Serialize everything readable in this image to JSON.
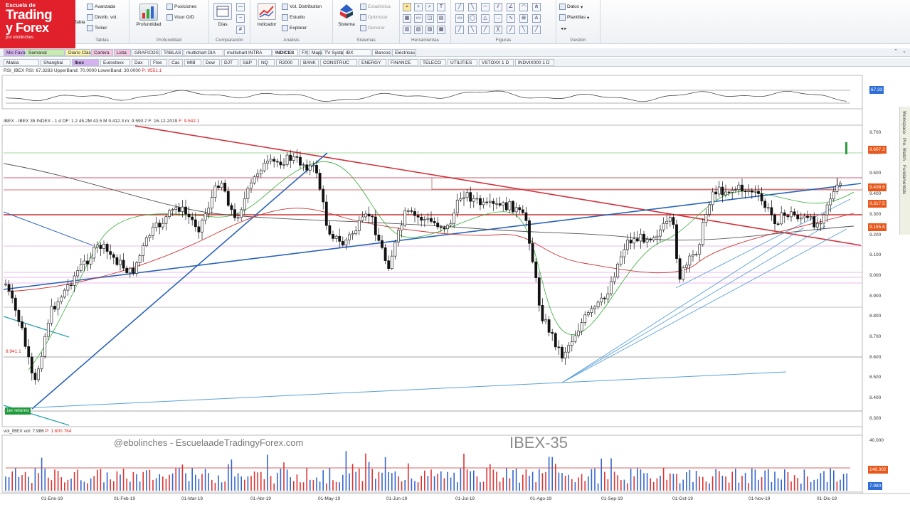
{
  "logo": {
    "line1": "Escuela de",
    "line2": "Trading",
    "line3": "y Forex",
    "line4": "por ebolinches"
  },
  "ribbon": {
    "groups": [
      {
        "title": "Tablas"
      },
      {
        "title": "Profundidad"
      },
      {
        "title": "Comparación"
      },
      {
        "title": "Análisis"
      },
      {
        "title": "Sistemas"
      },
      {
        "title": "Herramientas"
      },
      {
        "title": "Figuras"
      },
      {
        "title": "Gestión"
      }
    ],
    "items": {
      "tablas": [
        "Avanzada",
        "Distrib. vol.",
        "Ticker"
      ],
      "profundidad_big": "Profundidad",
      "profundidad": [
        "Posiciones",
        "Visor O/D"
      ],
      "comparacion_big": "Días",
      "analisis_big": "Indicador",
      "analisis": [
        "Vol. Distribution",
        "Estudio",
        "Explorer"
      ],
      "sistemas_big": "Sistema",
      "sistemas": [
        "Estadística",
        "Optimizar",
        "Generar"
      ],
      "gestion": [
        "Datos",
        "Plantillas"
      ],
      "tablas_big": "Tabla"
    }
  },
  "tabs_row1": [
    "Mis Favoritos",
    "Semanal",
    "Diario Clásico",
    "Cartera",
    "Lista",
    "GRAFICOS",
    "TABLAS",
    "multichart DIA",
    "multichart INTRA",
    "INDICES",
    "FX",
    "Mapas",
    "TV System",
    "IBX",
    "Bancos",
    "Eléctricas"
  ],
  "tabs_row2": [
    "Makia",
    "Shanghai",
    "Ibex",
    "Eurostoxx",
    "Dax",
    "Ftse",
    "Cac",
    "MIB",
    "Dow",
    "DJT",
    "S&P",
    "NQ",
    "R2000",
    "BANK",
    "CONSTRUC",
    "ENERGY",
    "FINANCE",
    "TELECO",
    "UTILITIES",
    "VSTOXX 1 D",
    "INDVIX000 1 D"
  ],
  "rsi_panel": {
    "label": "RSI_IBEX RSI: 67.3283 UpperBand: 70.0000 LowerBand: 30.0000",
    "label_red": "P: 9551.1",
    "value_tag": "67.33"
  },
  "price_panel": {
    "label": "IBEX - IBEX 35 INDEX - 1 d DF: 1.2 45.2M 43.5 M 9.412.3 m: 9.590.7 F: 16-12-2019",
    "label_red": "F: 9.542.1",
    "left_tag": "9.941.1",
    "green_tag": "1er retorno",
    "axis": [
      "9.700",
      "9.600",
      "9.500",
      "9.400",
      "9.300",
      "9.200",
      "9.100",
      "9.000",
      "8.900",
      "8.800",
      "8.700",
      "8.600",
      "8.500",
      "8.400",
      "8.300"
    ],
    "tags": [
      {
        "text": "9.607.3",
        "color": "#e8581c"
      },
      {
        "text": "9.408.6",
        "color": "#e8581c"
      },
      {
        "text": "9.317.5",
        "color": "#e8581c"
      },
      {
        "text": "9.155.6",
        "color": "#e8581c"
      }
    ]
  },
  "volume_panel": {
    "label": "vol_IBEX vol: 7.986",
    "label_red": "P: 1.600.784",
    "axis_top": "40.000",
    "tags": [
      {
        "text": "146.302",
        "color": "#e8581c"
      },
      {
        "text": "7.980",
        "color": "#2f6fd6"
      }
    ],
    "watermark": "@ebolinches - EscuelaadeTradingyForex.com",
    "title": "IBEX-35"
  },
  "x_axis": [
    "01-Ene-19",
    "01-Feb-19",
    "01-Mar-19",
    "01-Abr-19",
    "01-May-19",
    "01-Jun-19",
    "01-Jul-19",
    "01-Ago-19",
    "01-Sep-19",
    "01-Oct-19",
    "01-Nov-19",
    "01-Dic-19"
  ],
  "side_strip": [
    "Workspace",
    "Pro. Watch",
    "Fundamentals"
  ],
  "colors": {
    "logo": "#e0202a",
    "tag_orange": "#e8581c",
    "tag_blue": "#2f6fd6",
    "trend_red": "#d0303a",
    "trend_blue": "#2a63b8"
  }
}
